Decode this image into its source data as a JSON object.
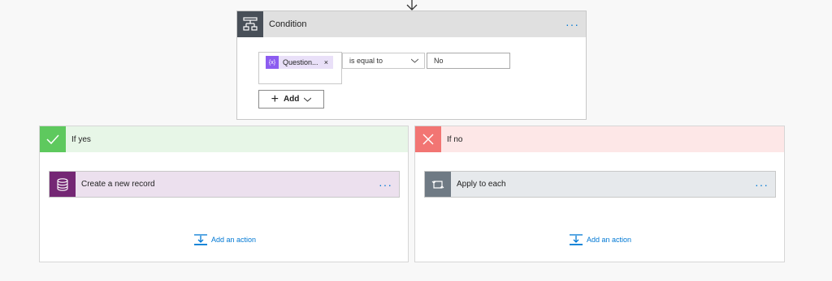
{
  "condition": {
    "title": "Condition",
    "more_label": "···",
    "token": {
      "label": "Question...",
      "icon_text": "{x}",
      "remove_label": "×"
    },
    "operator": "is equal to",
    "value": "No",
    "add_label": "Add",
    "add_plus": "+"
  },
  "if_yes": {
    "title": "If yes",
    "action": {
      "title": "Create a new record",
      "more_label": "···"
    },
    "add_action_label": "Add an action"
  },
  "if_no": {
    "title": "If no",
    "action": {
      "title": "Apply to each",
      "more_label": "···"
    },
    "add_action_label": "Add an action"
  },
  "colors": {
    "accent": "#0078d4",
    "yes": "#5ec95e",
    "no": "#f27573",
    "dataverse": "#742774",
    "condition_icon": "#484f58"
  }
}
